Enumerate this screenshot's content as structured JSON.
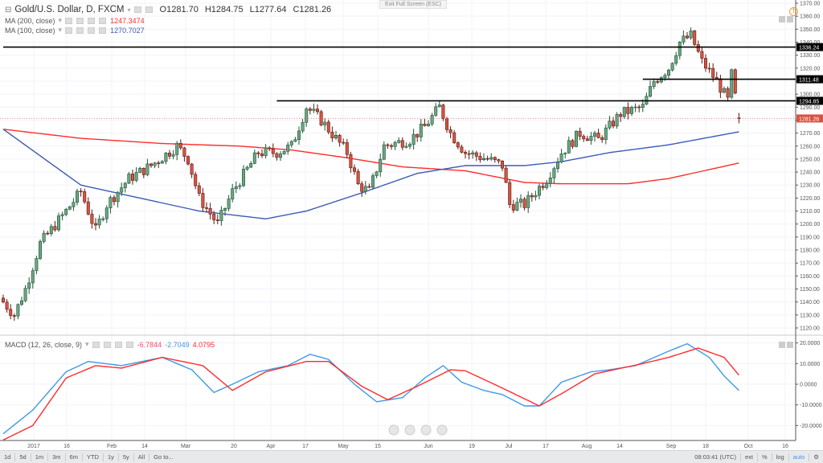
{
  "header": {
    "symbol": "Gold/U.S. Dollar, D, FXCM",
    "open": "O1281.70",
    "high": "H1284.75",
    "low": "L1277.64",
    "close": "C1281.26",
    "exit_fullscreen": "Exit Full Screen (ESC)",
    "warning_icon": "!"
  },
  "indicators": [
    {
      "label": "MA (200, close)",
      "value": "1247.3474",
      "color": "#ff2b2b"
    },
    {
      "label": "MA (100, close)",
      "value": "1270.7027",
      "color": "#3b5bb5"
    }
  ],
  "macd": {
    "label": "MACD (12, 26, close, 9)",
    "hist": "-6.7844",
    "macd": "-2.7049",
    "signal": "4.0795"
  },
  "price_axis": {
    "ticks": [
      "1370.00",
      "1360.00",
      "1350.00",
      "1340.00",
      "1330.00",
      "1320.00",
      "1310.00",
      "1300.00",
      "1290.00",
      "1280.00",
      "1270.00",
      "1260.00",
      "1250.00",
      "1240.00",
      "1230.00",
      "1220.00",
      "1210.00",
      "1200.00",
      "1190.00",
      "1180.00",
      "1170.00",
      "1160.00",
      "1150.00",
      "1140.00",
      "1130.00",
      "1120.00"
    ]
  },
  "macd_axis": {
    "ticks": [
      "20.0000",
      "10.0000",
      "0.0000",
      "-10.0000",
      "-20.0000"
    ]
  },
  "time_axis": {
    "labels": [
      "2017",
      "16",
      "Feb",
      "14",
      "Mar",
      "20",
      "Apr",
      "17",
      "May",
      "15",
      "Jun",
      "19",
      "Jul",
      "17",
      "Aug",
      "14",
      "Sep",
      "18",
      "Oct",
      "16"
    ]
  },
  "levels": [
    {
      "price": 1336.24,
      "label": "1336.24",
      "from_day": 0
    },
    {
      "price": 1311.48,
      "label": "1311.48",
      "from_day": 173
    },
    {
      "price": 1294.85,
      "label": "1294.85",
      "from_day": 74
    }
  ],
  "last_price": {
    "price": 1281.26,
    "label": "1281.26"
  },
  "toolbar": {
    "ranges": [
      "1d",
      "5d",
      "1m",
      "3m",
      "6m",
      "YTD",
      "1y",
      "5y",
      "All",
      "Go to..."
    ],
    "time": "08:03:41 (UTC)",
    "options": [
      "ext",
      "%",
      "log",
      "auto"
    ]
  },
  "chart_data": {
    "type": "candlestick",
    "title": "Gold/U.S. Dollar, D, FXCM",
    "close_anchors": [
      [
        0,
        1140
      ],
      [
        3,
        1130
      ],
      [
        6,
        1150
      ],
      [
        10,
        1185
      ],
      [
        17,
        1210
      ],
      [
        21,
        1225
      ],
      [
        25,
        1195
      ],
      [
        28,
        1215
      ],
      [
        34,
        1235
      ],
      [
        40,
        1245
      ],
      [
        47,
        1260
      ],
      [
        50,
        1250
      ],
      [
        53,
        1220
      ],
      [
        58,
        1200
      ],
      [
        62,
        1225
      ],
      [
        69,
        1255
      ],
      [
        74,
        1255
      ],
      [
        78,
        1260
      ],
      [
        82,
        1290
      ],
      [
        86,
        1280
      ],
      [
        93,
        1255
      ],
      [
        96,
        1230
      ],
      [
        99,
        1225
      ],
      [
        103,
        1260
      ],
      [
        110,
        1265
      ],
      [
        114,
        1275
      ],
      [
        118,
        1290
      ],
      [
        121,
        1270
      ],
      [
        125,
        1255
      ],
      [
        131,
        1250
      ],
      [
        135,
        1245
      ],
      [
        137,
        1215
      ],
      [
        141,
        1215
      ],
      [
        147,
        1235
      ],
      [
        151,
        1255
      ],
      [
        156,
        1270
      ],
      [
        161,
        1265
      ],
      [
        167,
        1285
      ],
      [
        173,
        1290
      ],
      [
        176,
        1310
      ],
      [
        180,
        1320
      ],
      [
        183,
        1340
      ],
      [
        186,
        1345
      ],
      [
        189,
        1325
      ],
      [
        193,
        1310
      ],
      [
        196,
        1295
      ],
      [
        197,
        1315
      ],
      [
        199,
        1281.26
      ]
    ],
    "ma100": [
      [
        0,
        1273
      ],
      [
        21,
        1230
      ],
      [
        53,
        1210
      ],
      [
        71,
        1204
      ],
      [
        82,
        1210
      ],
      [
        97,
        1224
      ],
      [
        112,
        1239
      ],
      [
        125,
        1245
      ],
      [
        141,
        1245
      ],
      [
        151,
        1248
      ],
      [
        164,
        1255
      ],
      [
        180,
        1261
      ],
      [
        199,
        1271
      ]
    ],
    "ma200": [
      [
        0,
        1273
      ],
      [
        21,
        1266
      ],
      [
        43,
        1262
      ],
      [
        64,
        1260
      ],
      [
        78,
        1257
      ],
      [
        93,
        1251
      ],
      [
        108,
        1244
      ],
      [
        125,
        1241
      ],
      [
        141,
        1232
      ],
      [
        151,
        1231
      ],
      [
        169,
        1231
      ],
      [
        180,
        1235
      ],
      [
        199,
        1247
      ]
    ],
    "macd_line": [
      [
        0,
        -24
      ],
      [
        8,
        -12.5
      ],
      [
        17,
        6
      ],
      [
        23,
        11
      ],
      [
        32,
        9
      ],
      [
        43,
        13
      ],
      [
        51,
        7
      ],
      [
        57,
        -4
      ],
      [
        62,
        0
      ],
      [
        69,
        6
      ],
      [
        77,
        9
      ],
      [
        83,
        14.5
      ],
      [
        88,
        12
      ],
      [
        95,
        0
      ],
      [
        101,
        -8.5
      ],
      [
        108,
        -6.5
      ],
      [
        114,
        3
      ],
      [
        119,
        9
      ],
      [
        124,
        1
      ],
      [
        130,
        -3
      ],
      [
        135,
        -5
      ],
      [
        141,
        -10.5
      ],
      [
        145,
        -10.5
      ],
      [
        151,
        1
      ],
      [
        159,
        6
      ],
      [
        164,
        7
      ],
      [
        171,
        9
      ],
      [
        180,
        16
      ],
      [
        185,
        19.6
      ],
      [
        191,
        13
      ],
      [
        195,
        4
      ],
      [
        199,
        -3
      ]
    ],
    "signal_line": [
      [
        0,
        -27
      ],
      [
        8,
        -20
      ],
      [
        17,
        3
      ],
      [
        25,
        9
      ],
      [
        32,
        7.8
      ],
      [
        43,
        13
      ],
      [
        54,
        9
      ],
      [
        62,
        -3
      ],
      [
        71,
        6
      ],
      [
        82,
        11
      ],
      [
        88,
        11
      ],
      [
        97,
        -1
      ],
      [
        104,
        -7.5
      ],
      [
        112,
        -1
      ],
      [
        121,
        7
      ],
      [
        125,
        6.5
      ],
      [
        134,
        -1
      ],
      [
        145,
        -10.5
      ],
      [
        151,
        -4.6
      ],
      [
        160,
        5
      ],
      [
        173,
        10
      ],
      [
        180,
        13
      ],
      [
        188,
        17.5
      ],
      [
        195,
        13
      ],
      [
        199,
        4.4
      ]
    ],
    "ylim": [
      1115,
      1372
    ],
    "macd_ylim": [
      -28,
      22
    ]
  }
}
